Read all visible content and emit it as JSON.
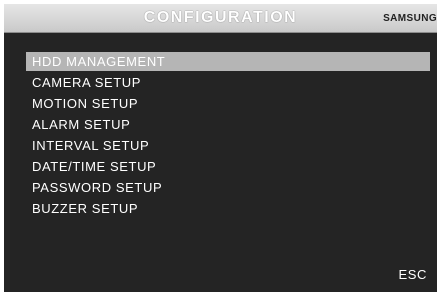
{
  "header": {
    "title": "CONFIGURATION",
    "brand": "SAMSUNG"
  },
  "menu": {
    "selected_index": 0,
    "items": [
      {
        "label": "HDD MANAGEMENT"
      },
      {
        "label": "CAMERA SETUP"
      },
      {
        "label": "MOTION SETUP"
      },
      {
        "label": "ALARM SETUP"
      },
      {
        "label": "INTERVAL SETUP"
      },
      {
        "label": "DATE/TIME SETUP"
      },
      {
        "label": "PASSWORD SETUP"
      },
      {
        "label": "BUZZER SETUP"
      }
    ]
  },
  "footer": {
    "esc_label": "ESC"
  },
  "colors": {
    "background": "#242424",
    "header_bar": "#d9d9d9",
    "selection": "#b5b5b5",
    "text": "#ffffff"
  }
}
